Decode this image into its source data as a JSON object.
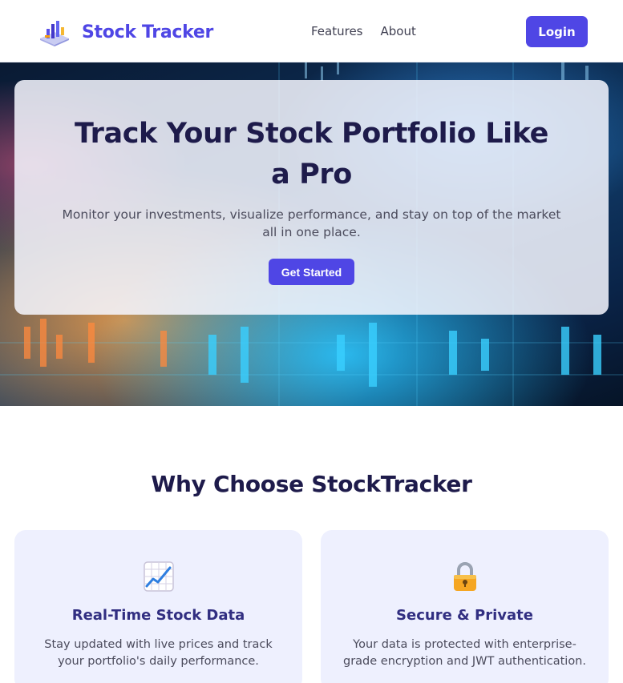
{
  "header": {
    "brand": "Stock Tracker",
    "logo_icon": "chart-bars-icon",
    "nav": [
      "Features",
      "About"
    ],
    "login_label": "Login"
  },
  "hero": {
    "title": "Track Your Stock Portfolio Like a Pro",
    "subtitle": "Monitor your investments, visualize performance, and stay on top of the market all in one place.",
    "cta_label": "Get Started"
  },
  "features": {
    "heading": "Why Choose StockTracker",
    "cards": [
      {
        "icon": "chart-increasing-icon",
        "title": "Real-Time Stock Data",
        "text": "Stay updated with live prices and track your portfolio's daily performance."
      },
      {
        "icon": "lock-icon",
        "title": "Secure & Private",
        "text": "Your data is protected with enterprise-grade encryption and JWT authentication."
      }
    ]
  },
  "colors": {
    "accent": "#4f46e5",
    "heading": "#1e1b4b",
    "card_bg": "#eef0fe"
  }
}
